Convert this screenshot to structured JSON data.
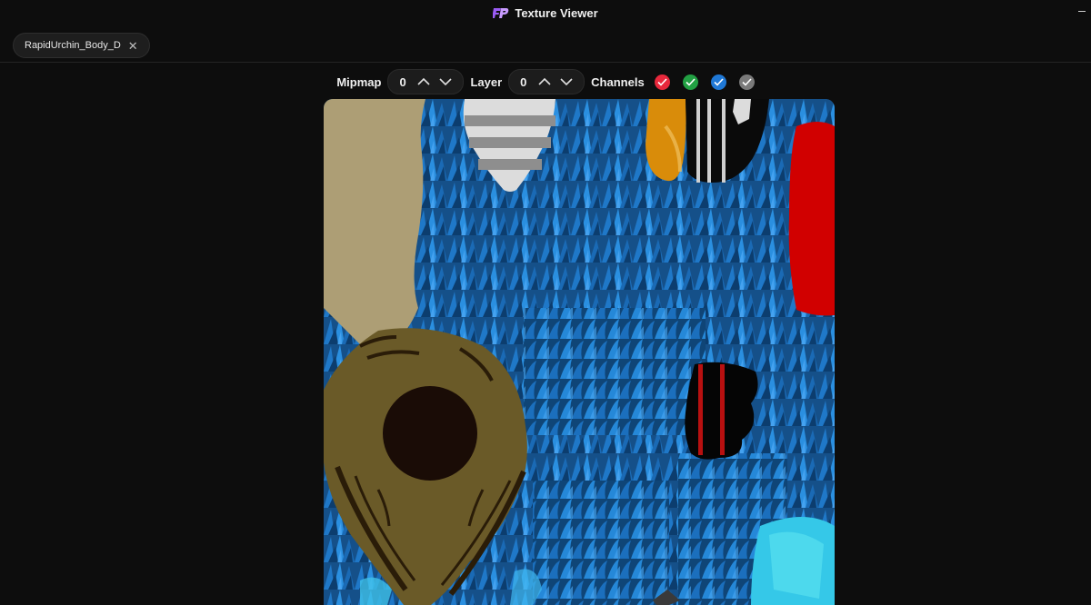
{
  "app": {
    "title": "Texture Viewer",
    "logo": "fp-logo-icon"
  },
  "tabs": [
    {
      "label": "RapidUrchin_Body_D"
    }
  ],
  "toolbar": {
    "mipmap_label": "Mipmap",
    "mipmap_value": "0",
    "layer_label": "Layer",
    "layer_value": "0",
    "channels_label": "Channels",
    "channels": [
      {
        "name": "red",
        "enabled": true,
        "color": "#e8283c"
      },
      {
        "name": "green",
        "enabled": true,
        "color": "#22a043"
      },
      {
        "name": "blue",
        "enabled": true,
        "color": "#1f78d6"
      },
      {
        "name": "alpha",
        "enabled": true,
        "color": "#7a7a7a"
      }
    ]
  },
  "colors": {
    "background": "#0d0d0d",
    "surface": "#1c1c1c",
    "accent_logo": "#9b5cf5"
  }
}
